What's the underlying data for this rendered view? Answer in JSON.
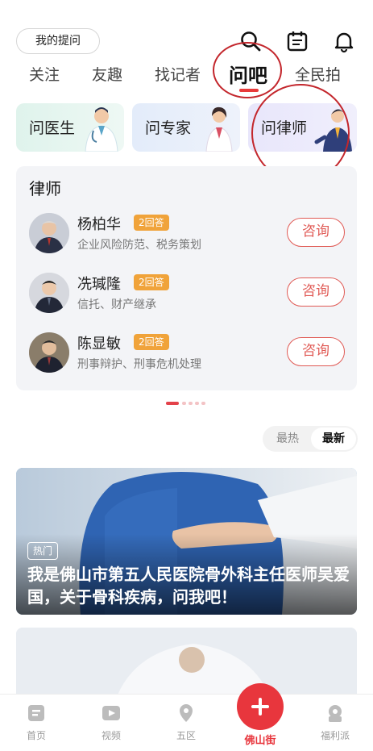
{
  "header": {
    "my_questions_label": "我的提问",
    "icons": [
      "search-icon",
      "calendar-icon",
      "bell-icon"
    ]
  },
  "tabs": [
    {
      "label": "关注",
      "active": false
    },
    {
      "label": "友趣",
      "active": false
    },
    {
      "label": "找记者",
      "active": false
    },
    {
      "label": "问吧",
      "active": true
    },
    {
      "label": "全民拍",
      "active": false
    }
  ],
  "category_cards": [
    {
      "label": "问医生"
    },
    {
      "label": "问专家"
    },
    {
      "label": "问律师"
    }
  ],
  "lawyer_section": {
    "title": "律师",
    "lawyers": [
      {
        "name": "杨柏华",
        "badge": "2回答",
        "desc": "企业风险防范、税务策划",
        "action": "咨询"
      },
      {
        "name": "冼瑊隆",
        "badge": "2回答",
        "desc": "信托、财产继承",
        "action": "咨询"
      },
      {
        "name": "陈显敏",
        "badge": "2回答",
        "desc": "刑事辩护、刑事危机处理",
        "action": "咨询"
      }
    ]
  },
  "pager": {
    "total": 5,
    "active_index": 0
  },
  "sort": {
    "hot_label": "最热",
    "new_label": "最新",
    "selected": "最新"
  },
  "posts": [
    {
      "badge": "热门",
      "title": "我是佛山市第五人民医院骨外科主任医师吴爱国，关于骨科疾病，问我吧！"
    }
  ],
  "bottom_nav": [
    {
      "label": "首页",
      "icon": "home-icon"
    },
    {
      "label": "视频",
      "icon": "video-icon"
    },
    {
      "label": "五区",
      "icon": "location-icon"
    },
    {
      "label": "佛山街",
      "icon": "plus-icon",
      "active": true
    },
    {
      "label": "福利派",
      "icon": "gift-icon"
    }
  ],
  "colors": {
    "accent": "#e8363d",
    "badge": "#f0a33a",
    "annotation": "#c3262c"
  }
}
